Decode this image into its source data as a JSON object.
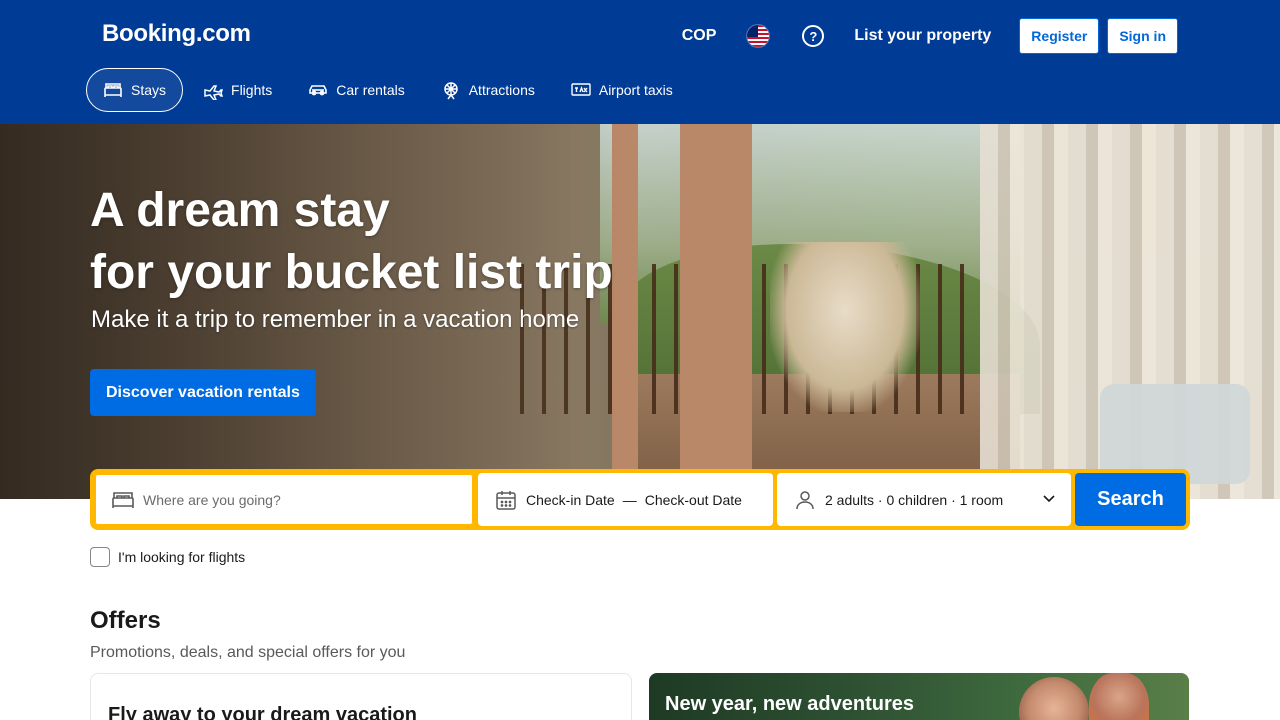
{
  "header": {
    "logo": "Booking.com",
    "currency": "COP",
    "help": "?",
    "list_property": "List your property",
    "register": "Register",
    "sign_in": "Sign in"
  },
  "nav": {
    "items": [
      {
        "label": "Stays",
        "icon": "bed-icon",
        "active": true
      },
      {
        "label": "Flights",
        "icon": "plane-icon",
        "active": false
      },
      {
        "label": "Car rentals",
        "icon": "car-icon",
        "active": false
      },
      {
        "label": "Attractions",
        "icon": "ferris-wheel-icon",
        "active": false
      },
      {
        "label": "Airport taxis",
        "icon": "taxi-icon",
        "active": false
      }
    ]
  },
  "hero": {
    "title_line1": "A dream stay",
    "title_line2": "for your bucket list trip",
    "subtitle": "Make it a trip to remember in a vacation home",
    "cta": "Discover vacation rentals"
  },
  "search": {
    "destination_placeholder": "Where are you going?",
    "checkin": "Check-in Date",
    "dash": "—",
    "checkout": "Check-out Date",
    "occupancy": "2 adults · 0 children · 1 room",
    "button": "Search"
  },
  "flights_checkbox": {
    "label": "I'm looking for flights",
    "checked": false
  },
  "offers": {
    "title": "Offers",
    "subtitle": "Promotions, deals, and special offers for you",
    "cards": [
      {
        "title": "Fly away to your dream vacation"
      },
      {
        "title": "New year, new adventures"
      }
    ]
  },
  "colors": {
    "brand_blue": "#003b95",
    "action_blue": "#006ce4",
    "search_border": "#ffb700"
  }
}
